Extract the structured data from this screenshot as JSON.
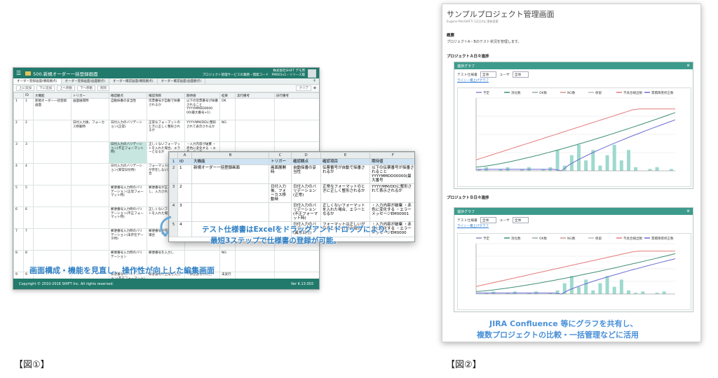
{
  "fig1": {
    "app_title": "500.新規オーダー一括登録画面",
    "company": "株式会社SHIFT デモ用",
    "project_line": "プロジェクト管理サービスの業務・開発コード　PM001v1・リリース版",
    "tabs": [
      {
        "label": "オーダー登録画面(機能観点)"
      },
      {
        "label": "オーダー登録画面(画面観点)"
      },
      {
        "label": "オーダー確認画面(機能観点)"
      },
      {
        "label": "オーダー確認画面(画面観点)"
      }
    ],
    "toolbar": {
      "b1": "上に追加",
      "b2": "下に追加",
      "b3": "上へ移動",
      "b4": "下へ移動",
      "b5": "削除",
      "clear": "クリア"
    },
    "columns": [
      "ID",
      "大機能",
      "トリガー",
      "確認観点",
      "確認項目",
      "期待値",
      "結果",
      "実行備考",
      "旧行備考"
    ],
    "rows": [
      {
        "num": "1",
        "id": "1",
        "func": "新規オーダー一括登録画面",
        "trigger": "画面展開時",
        "viewpoint": "自動採番の妥当性",
        "item": "伝票番号が自動で採番されるか",
        "expected": "以下の伝票番号が採番されること YYYYMMDD0000 00(最大番号+1)",
        "result": "OK"
      },
      {
        "num": "2",
        "id": "2",
        "func": "",
        "trigger": "日付入力後、フォーカス移動時",
        "viewpoint": "日付入力のバリデーション(正常)",
        "item": "正常なフォーマットのときに正しく整形されるか",
        "expected": "YYYY/MM/DDに整形されて表示されるか",
        "result": "NG"
      },
      {
        "num": "3",
        "id": "3",
        "func": "",
        "trigger": "",
        "viewpoint": "日付入力のバリデーション(不正フォーマット時)",
        "item": "正しくないフォーマットを入れた場合、エラーとなるか",
        "expected": "・入力内容が破棄 ・赤色に変化する ・エラーメッセー",
        "result": ""
      },
      {
        "num": "4",
        "id": "4",
        "func": "",
        "trigger": "",
        "viewpoint": "日付入力のバリデーション(異常日付時)",
        "item": "フォーマットは正しいが存在しない日付の場合",
        "expected": "",
        "result": ""
      },
      {
        "num": "5",
        "id": "5",
        "func": "",
        "trigger": "",
        "viewpoint": "郵便番号入力時のバリデーション(正常フォーマット時)",
        "item": "郵便番号が正しく使用し、入力されるか",
        "expected": "",
        "result": ""
      },
      {
        "num": "6",
        "id": "6",
        "func": "",
        "trigger": "",
        "viewpoint": "郵便番号入力時のバリデーション(不正フォーマット時)",
        "item": "正しくないフォーマットを入れた場合",
        "expected": "",
        "result": ""
      },
      {
        "num": "7",
        "id": "7",
        "func": "",
        "trigger": "",
        "viewpoint": "郵便番号入力時のバリデーション(未存在データ時)",
        "item": "郵便番号が存在しない場合",
        "expected": "・エラーメッセージEM00004が表示されること",
        "result": ""
      },
      {
        "num": "8",
        "id": "8",
        "func": "",
        "trigger": "",
        "viewpoint": "郵便番号入力時のバリデーション",
        "item": "郵便番号を入力し",
        "expected": "",
        "result": "NG"
      },
      {
        "num": "9",
        "id": "9",
        "func": "",
        "trigger": "",
        "viewpoint": "郵便番号のバリデーション(不正フォーマット)",
        "item": "郵便番号に全角を入力",
        "expected": "・郵便番号の入力",
        "result": "未実行"
      }
    ],
    "footer_copyright": "Copyright © 2010-2016 SHIFT Inc. All rights reserved.",
    "footer_version": "Ver K.13.003"
  },
  "excel": {
    "col_letters": [
      "A",
      "B",
      "C",
      "D",
      "E",
      "F"
    ],
    "header": [
      "ID",
      "大機能",
      "トリガー",
      "確認観点",
      "確認項目",
      "期待値"
    ],
    "rows": [
      {
        "rn": "2",
        "id": "1",
        "func": "新規オーダー一括登録画面",
        "trigger": "画面展開時",
        "view": "自動採番の妥当性",
        "item": "伝票番号が自動で採番されるか",
        "expected": "以下の伝票番号が採番されること YYYYMMDD00000(最大番号"
      },
      {
        "rn": "3",
        "id": "2",
        "func": "",
        "trigger": "日付入力後、フォーカス移動時",
        "view": "日付入力のバリデーション(正常)",
        "item": "正常なフォーマットのときに正しく整形されるか",
        "expected": "YYYY/MM/DDに整形されて表示されるか"
      },
      {
        "rn": "4",
        "id": "3",
        "func": "",
        "trigger": "",
        "view": "日付入力のバリデーション(不正フォーマット時)",
        "item": "正しくないフォーマットを入れた場合、エラーとなるか",
        "expected": "・入力内容が破棄 ・赤色に変化する ・エラーメッセージEM00001"
      },
      {
        "rn": "5",
        "id": "4",
        "func": "",
        "trigger": "",
        "view": "日付入力のバリデーション(異常日付)",
        "item": "フォーマットは正しいが存在しない日付の場合",
        "expected": "・入力内容が破棄 ・赤色に変化する ・エラーメッセージEM0000"
      }
    ]
  },
  "captions": {
    "c1_line1": "テスト仕様書はExcelをドラッグアンドドロップにより、",
    "c1_line2": "最短3ステップで仕様書の登録が可能。",
    "c2": "画面構成・機能を見直し、操作性が向上した編集画面",
    "c3_line1": "JIRA Confluence 等にグラフを共有し、",
    "c3_line2": "複数プロジェクトの比較・一括管理などに活用",
    "label1": "【図①】",
    "label2": "【図②】"
  },
  "fig2": {
    "title": "サンプルプロジェクト管理画面",
    "subtitle": "Eugene Min(SHIFT) 1日日内に更新変更",
    "overview_h": "概要",
    "overview_p": "プロジェクトA・Bのテスト状況を管理します。",
    "sec_a": "プロジェクトＡ日々進捗",
    "sec_b": "プロジェクトＢ日々進捗",
    "panel_title": "進捗グラフ",
    "opt_label1": "テスト仕様書",
    "opt_val1": "全体",
    "opt_label2": "ユーザ",
    "opt_val2": "全体",
    "link": "ライン・積上げグラフ",
    "legend": [
      "予定",
      "消化数",
      "OK数",
      "NG数",
      "保留",
      "不具合検出数",
      "累積障害修正数"
    ]
  },
  "colors": {
    "app_green": "#217a6b",
    "caption_blue": "#2f7fc4",
    "panel_green": "#3d9b8c"
  }
}
